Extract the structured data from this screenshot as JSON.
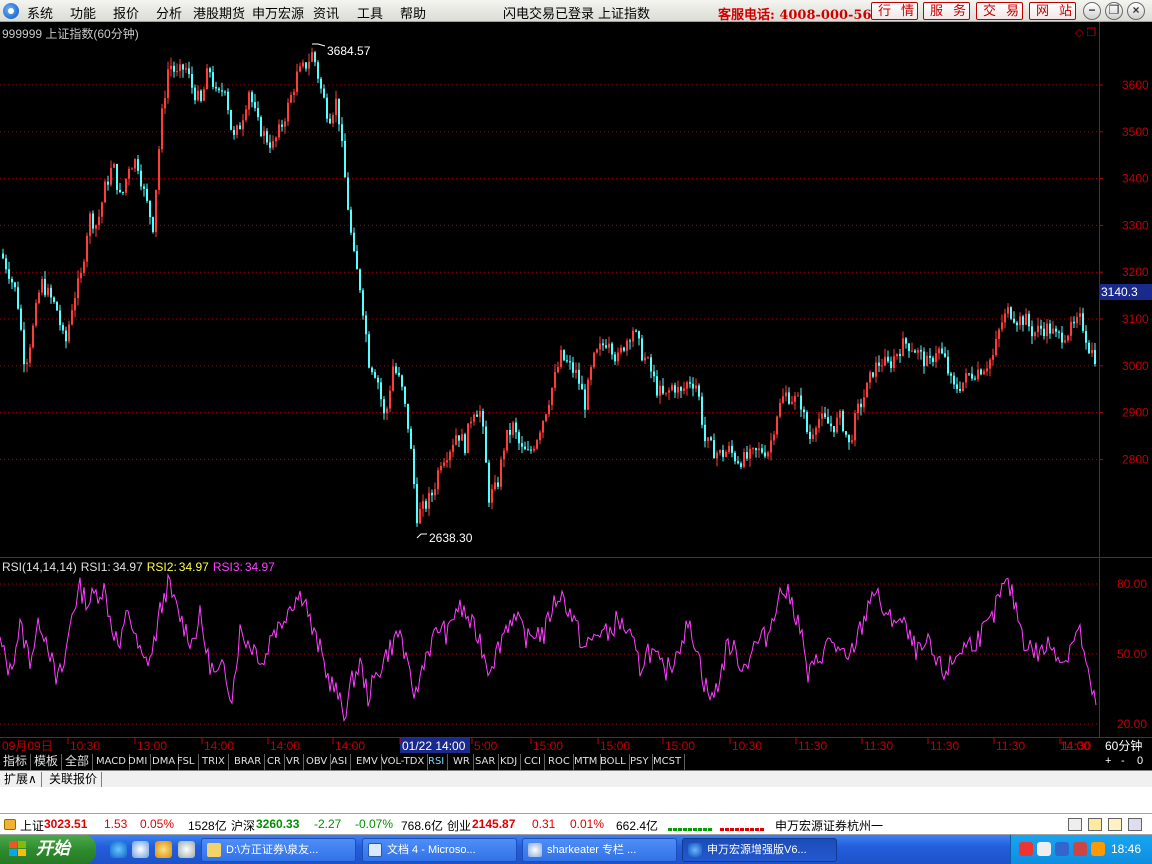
{
  "menu": {
    "items": [
      "系统",
      "功能",
      "报价",
      "分析",
      "港股期货",
      "申万宏源",
      "资讯",
      "工具",
      "帮助"
    ],
    "login_status": "闪电交易已登录",
    "current_symbol": "上证指数",
    "hotline": "客服电话: 4008-000-562",
    "buttons": [
      "行情",
      "服务",
      "交易",
      "网站"
    ]
  },
  "chart": {
    "title": "999999 上证指数(60分钟)",
    "high_label": "3684.57",
    "low_label": "2638.30",
    "current_price": "3140.3",
    "price_ticks": [
      "3600",
      "3500",
      "3400",
      "3300",
      "3200",
      "3100",
      "3000",
      "2900",
      "2800"
    ],
    "time_labels": [
      "09月09日",
      "10:30",
      "13:00",
      "14:00",
      "14:00",
      "14:00",
      "01/22 14:00",
      "5:00",
      "15:00",
      "15:00",
      "15:00",
      "10:30",
      "11:30",
      "11:30",
      "11:30",
      "11:30",
      "11:30",
      "14:00"
    ],
    "period": "60分钟",
    "colors": {
      "up": "#ff3c3c",
      "down": "#54ffff",
      "rsi": "#ff40ff",
      "grid": "#b00000",
      "axis": "#c00000"
    }
  },
  "rsi": {
    "name": "RSI(14,14,14)",
    "rsi1_label": "RSI1:",
    "rsi1": "34.97",
    "rsi2_label": "RSI2:",
    "rsi2": "34.97",
    "rsi3_label": "RSI3:",
    "rsi3": "34.97",
    "ticks": [
      "80.00",
      "50.00",
      "20.00"
    ]
  },
  "chart_data": {
    "type": "candlestick",
    "title": "999999 上证指数(60分钟)",
    "ylim": [
      2580,
      3720
    ],
    "price_path": [
      [
        0,
        3240
      ],
      [
        8,
        3200
      ],
      [
        16,
        3150
      ],
      [
        24,
        3000
      ],
      [
        32,
        3080
      ],
      [
        40,
        3180
      ],
      [
        48,
        3150
      ],
      [
        56,
        3120
      ],
      [
        64,
        3040
      ],
      [
        72,
        3140
      ],
      [
        80,
        3190
      ],
      [
        88,
        3320
      ],
      [
        96,
        3300
      ],
      [
        104,
        3380
      ],
      [
        112,
        3430
      ],
      [
        120,
        3350
      ],
      [
        128,
        3430
      ],
      [
        136,
        3440
      ],
      [
        144,
        3360
      ],
      [
        152,
        3300
      ],
      [
        160,
        3520
      ],
      [
        168,
        3650
      ],
      [
        176,
        3620
      ],
      [
        184,
        3640
      ],
      [
        192,
        3590
      ],
      [
        200,
        3560
      ],
      [
        208,
        3640
      ],
      [
        216,
        3570
      ],
      [
        224,
        3600
      ],
      [
        232,
        3480
      ],
      [
        240,
        3520
      ],
      [
        248,
        3590
      ],
      [
        256,
        3520
      ],
      [
        264,
        3490
      ],
      [
        272,
        3470
      ],
      [
        280,
        3510
      ],
      [
        288,
        3560
      ],
      [
        296,
        3620
      ],
      [
        304,
        3640
      ],
      [
        312,
        3670
      ],
      [
        320,
        3590
      ],
      [
        328,
        3530
      ],
      [
        336,
        3570
      ],
      [
        344,
        3400
      ],
      [
        352,
        3240
      ],
      [
        360,
        3160
      ],
      [
        368,
        3010
      ],
      [
        376,
        2980
      ],
      [
        384,
        2880
      ],
      [
        392,
        3000
      ],
      [
        400,
        2960
      ],
      [
        408,
        2860
      ],
      [
        416,
        2680
      ],
      [
        424,
        2700
      ],
      [
        432,
        2730
      ],
      [
        440,
        2800
      ],
      [
        448,
        2820
      ],
      [
        456,
        2860
      ],
      [
        464,
        2830
      ],
      [
        472,
        2910
      ],
      [
        480,
        2900
      ],
      [
        488,
        2720
      ],
      [
        496,
        2740
      ],
      [
        504,
        2840
      ],
      [
        512,
        2870
      ],
      [
        520,
        2820
      ],
      [
        528,
        2810
      ],
      [
        536,
        2850
      ],
      [
        544,
        2900
      ],
      [
        552,
        2960
      ],
      [
        560,
        3020
      ],
      [
        568,
        3000
      ],
      [
        576,
        2980
      ],
      [
        584,
        2920
      ],
      [
        592,
        3010
      ],
      [
        600,
        3040
      ],
      [
        608,
        3060
      ],
      [
        616,
        3010
      ],
      [
        624,
        3050
      ],
      [
        632,
        3080
      ],
      [
        640,
        3030
      ],
      [
        648,
        3000
      ],
      [
        656,
        2950
      ],
      [
        664,
        2930
      ],
      [
        672,
        2960
      ],
      [
        680,
        2940
      ],
      [
        688,
        2970
      ],
      [
        696,
        2960
      ],
      [
        704,
        2840
      ],
      [
        712,
        2820
      ],
      [
        720,
        2810
      ],
      [
        728,
        2820
      ],
      [
        736,
        2800
      ],
      [
        744,
        2800
      ],
      [
        752,
        2810
      ],
      [
        760,
        2820
      ],
      [
        768,
        2820
      ],
      [
        776,
        2900
      ],
      [
        784,
        2940
      ],
      [
        792,
        2930
      ],
      [
        800,
        2920
      ],
      [
        808,
        2840
      ],
      [
        816,
        2890
      ],
      [
        824,
        2880
      ],
      [
        832,
        2870
      ],
      [
        840,
        2890
      ],
      [
        848,
        2830
      ],
      [
        856,
        2900
      ],
      [
        864,
        2940
      ],
      [
        872,
        2990
      ],
      [
        880,
        3010
      ],
      [
        888,
        3000
      ],
      [
        896,
        3030
      ],
      [
        904,
        3050
      ],
      [
        912,
        3040
      ],
      [
        920,
        3020
      ],
      [
        928,
        3000
      ],
      [
        936,
        3040
      ],
      [
        944,
        3010
      ],
      [
        952,
        2950
      ],
      [
        960,
        2960
      ],
      [
        968,
        2980
      ],
      [
        976,
        2990
      ],
      [
        984,
        3000
      ],
      [
        992,
        3020
      ],
      [
        1000,
        3090
      ],
      [
        1008,
        3120
      ],
      [
        1016,
        3100
      ],
      [
        1024,
        3100
      ],
      [
        1032,
        3070
      ],
      [
        1040,
        3080
      ],
      [
        1048,
        3080
      ],
      [
        1056,
        3060
      ],
      [
        1064,
        3070
      ],
      [
        1072,
        3080
      ],
      [
        1080,
        3100
      ],
      [
        1088,
        3040
      ],
      [
        1094,
        3020
      ]
    ],
    "rsi_path": [
      [
        0,
        55
      ],
      [
        10,
        42
      ],
      [
        20,
        62
      ],
      [
        30,
        48
      ],
      [
        40,
        64
      ],
      [
        48,
        55
      ],
      [
        56,
        38
      ],
      [
        64,
        45
      ],
      [
        72,
        68
      ],
      [
        80,
        78
      ],
      [
        88,
        72
      ],
      [
        96,
        76
      ],
      [
        104,
        78
      ],
      [
        112,
        62
      ],
      [
        120,
        52
      ],
      [
        128,
        70
      ],
      [
        136,
        55
      ],
      [
        144,
        46
      ],
      [
        152,
        50
      ],
      [
        160,
        68
      ],
      [
        168,
        80
      ],
      [
        176,
        70
      ],
      [
        184,
        62
      ],
      [
        192,
        55
      ],
      [
        200,
        66
      ],
      [
        208,
        48
      ],
      [
        216,
        40
      ],
      [
        224,
        44
      ],
      [
        232,
        32
      ],
      [
        240,
        60
      ],
      [
        248,
        55
      ],
      [
        256,
        52
      ],
      [
        264,
        46
      ],
      [
        272,
        60
      ],
      [
        280,
        62
      ],
      [
        288,
        70
      ],
      [
        296,
        74
      ],
      [
        304,
        76
      ],
      [
        312,
        60
      ],
      [
        320,
        52
      ],
      [
        328,
        40
      ],
      [
        336,
        34
      ],
      [
        344,
        24
      ],
      [
        352,
        38
      ],
      [
        360,
        46
      ],
      [
        368,
        32
      ],
      [
        376,
        40
      ],
      [
        384,
        48
      ],
      [
        392,
        54
      ],
      [
        400,
        60
      ],
      [
        408,
        42
      ],
      [
        416,
        32
      ],
      [
        424,
        48
      ],
      [
        432,
        55
      ],
      [
        440,
        62
      ],
      [
        448,
        58
      ],
      [
        456,
        70
      ],
      [
        464,
        68
      ],
      [
        472,
        62
      ],
      [
        480,
        56
      ],
      [
        488,
        44
      ],
      [
        496,
        50
      ],
      [
        504,
        60
      ],
      [
        512,
        66
      ],
      [
        520,
        62
      ],
      [
        528,
        56
      ],
      [
        536,
        60
      ],
      [
        544,
        58
      ],
      [
        552,
        70
      ],
      [
        560,
        76
      ],
      [
        568,
        70
      ],
      [
        576,
        62
      ],
      [
        584,
        52
      ],
      [
        592,
        56
      ],
      [
        600,
        60
      ],
      [
        608,
        58
      ],
      [
        616,
        64
      ],
      [
        624,
        62
      ],
      [
        632,
        55
      ],
      [
        640,
        44
      ],
      [
        648,
        52
      ],
      [
        656,
        48
      ],
      [
        664,
        42
      ],
      [
        672,
        46
      ],
      [
        680,
        55
      ],
      [
        688,
        62
      ],
      [
        696,
        55
      ],
      [
        704,
        38
      ],
      [
        712,
        30
      ],
      [
        720,
        40
      ],
      [
        728,
        55
      ],
      [
        736,
        50
      ],
      [
        744,
        44
      ],
      [
        752,
        52
      ],
      [
        760,
        56
      ],
      [
        768,
        58
      ],
      [
        776,
        72
      ],
      [
        784,
        78
      ],
      [
        792,
        72
      ],
      [
        800,
        62
      ],
      [
        808,
        40
      ],
      [
        816,
        46
      ],
      [
        824,
        52
      ],
      [
        832,
        56
      ],
      [
        840,
        50
      ],
      [
        848,
        46
      ],
      [
        856,
        56
      ],
      [
        864,
        64
      ],
      [
        872,
        78
      ],
      [
        880,
        72
      ],
      [
        888,
        64
      ],
      [
        896,
        66
      ],
      [
        904,
        62
      ],
      [
        912,
        54
      ],
      [
        920,
        50
      ],
      [
        928,
        54
      ],
      [
        936,
        46
      ],
      [
        944,
        42
      ],
      [
        952,
        46
      ],
      [
        960,
        52
      ],
      [
        968,
        54
      ],
      [
        976,
        56
      ],
      [
        984,
        60
      ],
      [
        992,
        64
      ],
      [
        1000,
        76
      ],
      [
        1008,
        80
      ],
      [
        1016,
        70
      ],
      [
        1024,
        56
      ],
      [
        1032,
        52
      ],
      [
        1040,
        50
      ],
      [
        1048,
        54
      ],
      [
        1056,
        52
      ],
      [
        1064,
        46
      ],
      [
        1072,
        56
      ],
      [
        1080,
        60
      ],
      [
        1088,
        40
      ],
      [
        1094,
        30
      ]
    ]
  },
  "indicators": {
    "left_tabs": [
      "指标",
      "模板",
      "全部"
    ],
    "tabs": [
      "MACD",
      "DMI",
      "DMA",
      "FSL",
      "TRIX",
      "BRAR",
      "CR",
      "VR",
      "OBV",
      "ASI",
      "EMV",
      "VOL-TDX",
      "RSI",
      "WR",
      "SAR",
      "KDJ",
      "CCI",
      "ROC",
      "MTM",
      "BOLL",
      "PSY",
      "MCST"
    ],
    "active": "RSI",
    "right_controls": [
      "+",
      "-",
      "0"
    ]
  },
  "ext_tabs": [
    "扩展∧",
    "关联报价"
  ],
  "status": {
    "sh_label": "上证",
    "sh_price": "3023.51",
    "sh_change": "1.53",
    "sh_pct": "0.05%",
    "sh_amount": "1528亿",
    "sz_label": "沪深",
    "sz_price": "3260.33",
    "sz_change": "-2.27",
    "sz_pct": "-0.07%",
    "sz_amount": "768.6亿",
    "cy_label": "创业",
    "cy_price": "2145.87",
    "cy_change": "0.31",
    "cy_pct": "0.01%",
    "cy_amount": "662.4亿",
    "broker": "申万宏源证券杭州一"
  },
  "taskbar": {
    "start": "开始",
    "tasks": [
      "D:\\方正证券\\泉友...",
      "文档 4 - Microso...",
      "sharkeater 专栏 ...",
      "申万宏源增强版V6..."
    ],
    "clock": "18:46"
  }
}
